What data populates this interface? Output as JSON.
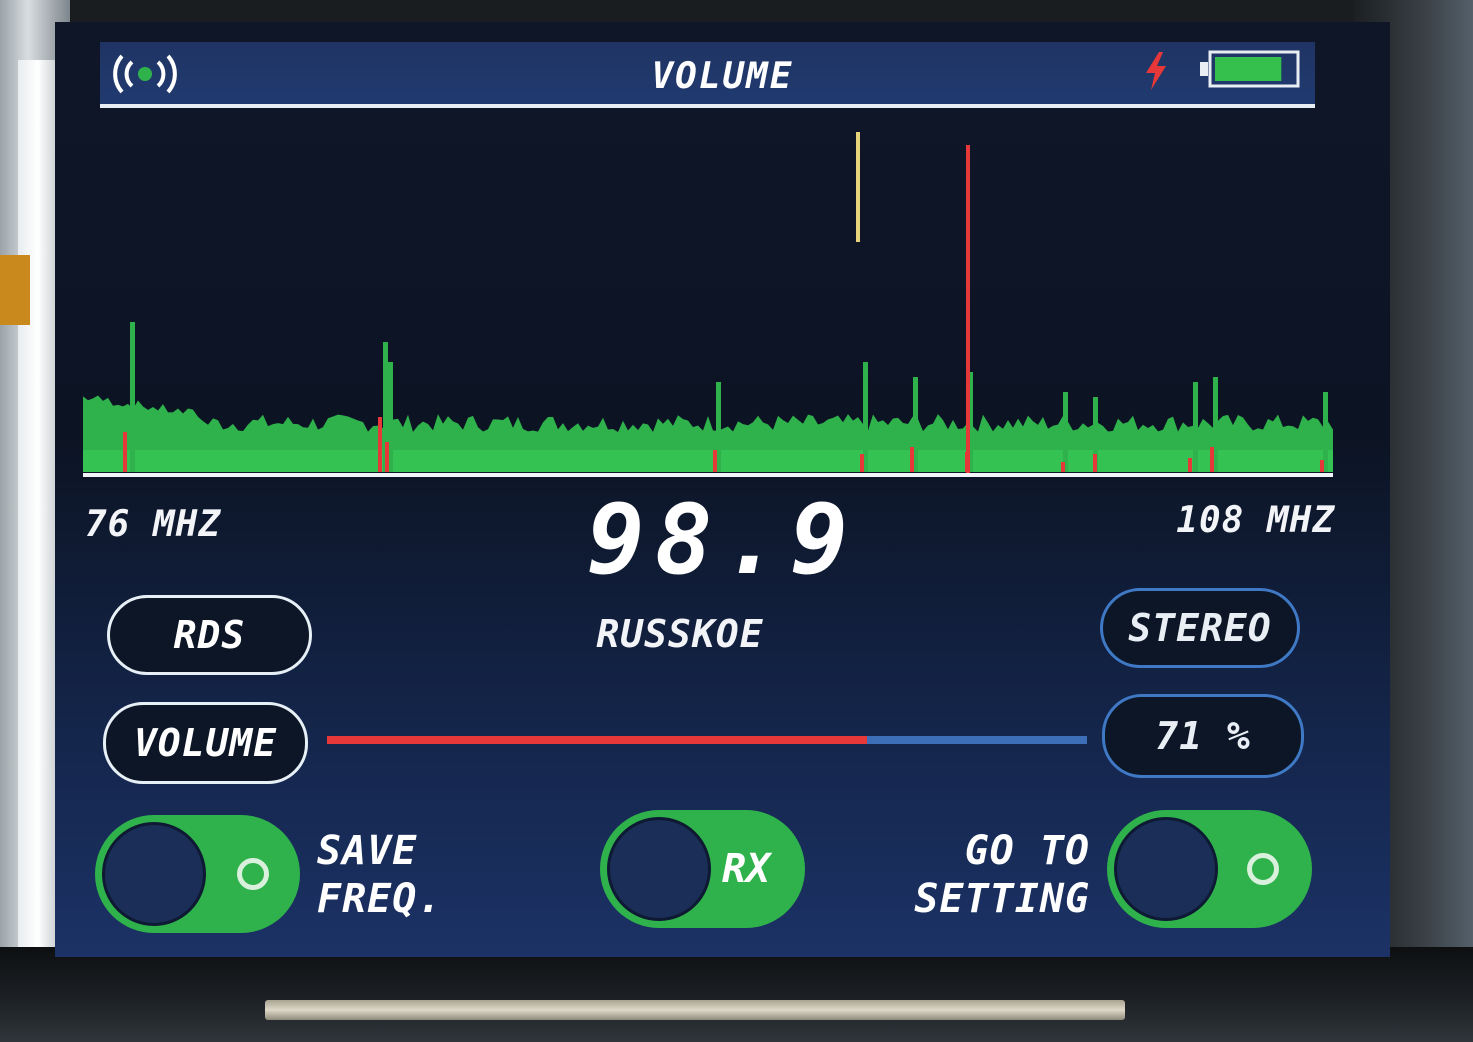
{
  "header": {
    "title": "VOLUME",
    "status_icons": [
      "radio-signal-icon",
      "charging-bolt-icon",
      "battery-icon"
    ],
    "battery_level": 0.85
  },
  "spectrum": {
    "band_low": "76 MHZ",
    "band_high": "108 MHZ",
    "colors": {
      "signal": "#2fb24b",
      "peak": "#e63838",
      "marker": "#e8d27a"
    }
  },
  "tuner": {
    "frequency": "98.9",
    "station": "RUSSKOE"
  },
  "buttons": {
    "rds": "RDS",
    "stereo": "STEREO",
    "volume": "VOLUME",
    "volume_percent": "71 %"
  },
  "volume": {
    "level_percent": 71
  },
  "toggles": {
    "save_line1": "SAVE",
    "save_line2": "FREQ.",
    "rx": "RX",
    "setting_line1": "GO TO",
    "setting_line2": "SETTING"
  },
  "colors": {
    "accent_green": "#2fb24b",
    "accent_red": "#e63838",
    "accent_blue": "#3f78c4",
    "screen_bg": "#0e1628"
  }
}
